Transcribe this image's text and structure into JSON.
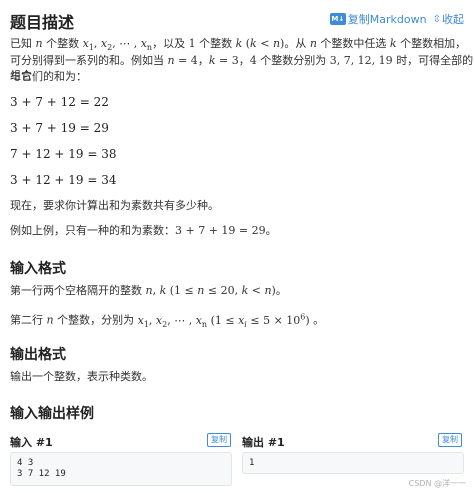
{
  "header": {
    "title": "题目描述",
    "copy_markdown": "复制Markdown",
    "md_badge": "M↓",
    "collapse": "收起",
    "collapse_icon": "double-chevron-icon"
  },
  "description": {
    "line1_a": "已知",
    "line1_b": "个整数",
    "line1_c": "，以及",
    "line1_d": "1",
    "line1_e": "个整数",
    "line1_f": "。从",
    "line1_g": "个整数中任选",
    "line1_h": "个整数相加，",
    "line2": "可分别得到一系列的和。例如当",
    "line2_b": "个整数分别为",
    "line2_c": "时，可得全部的组合",
    "line3": "与它们的和为：",
    "equations": [
      "3 + 7 + 12 = 22",
      "3 + 7 + 19 = 29",
      "7 + 12 + 19 = 38",
      "3 + 12 + 19 = 34"
    ],
    "task": "现在，要求你计算出和为素数共有多少种。",
    "example_a": "例如上例，只有一种的和为素数：",
    "example_math": "3 + 7 + 19 = 29",
    "example_end": "。"
  },
  "input_format": {
    "title": "输入格式",
    "line1_a": "第一行两个空格隔开的整数",
    "line1_end": "。",
    "line2_a": "第二行",
    "line2_b": "个整数，分别为",
    "line2_end": "。"
  },
  "output_format": {
    "title": "输出格式",
    "line1": "输出一个整数，表示种类数。"
  },
  "samples": {
    "title": "输入输出样例",
    "input_label": "输入 #1",
    "output_label": "输出 #1",
    "copy": "复制",
    "input_lines": [
      "4 3",
      "3 7 12 19"
    ],
    "output_lines": [
      "1"
    ]
  },
  "watermark": "CSDN @洋一一",
  "colors": {
    "accent": "#3e8bd7",
    "text": "#333333",
    "code_bg": "#f7f8fa"
  }
}
